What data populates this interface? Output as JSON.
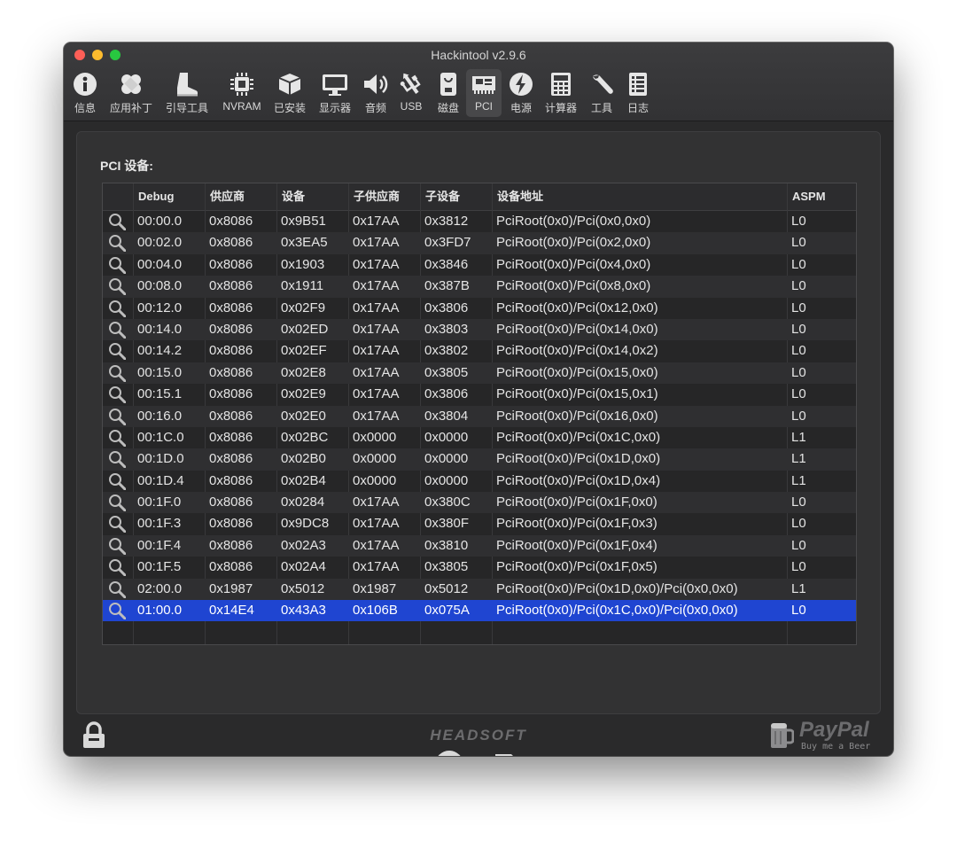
{
  "window": {
    "title": "Hackintool v2.9.6"
  },
  "toolbar": [
    {
      "label": "信息",
      "icon": "info-icon"
    },
    {
      "label": "应用补丁",
      "icon": "bandage-icon"
    },
    {
      "label": "引导工具",
      "icon": "boot-icon"
    },
    {
      "label": "NVRAM",
      "icon": "chip-icon"
    },
    {
      "label": "已安装",
      "icon": "box-icon"
    },
    {
      "label": "显示器",
      "icon": "monitor-icon"
    },
    {
      "label": "音频",
      "icon": "speaker-icon"
    },
    {
      "label": "USB",
      "icon": "usb-icon"
    },
    {
      "label": "磁盘",
      "icon": "disk-icon"
    },
    {
      "label": "PCI",
      "icon": "pci-card-icon",
      "active": true
    },
    {
      "label": "电源",
      "icon": "power-icon"
    },
    {
      "label": "计算器",
      "icon": "calculator-icon"
    },
    {
      "label": "工具",
      "icon": "wrench-icon"
    },
    {
      "label": "日志",
      "icon": "log-icon"
    }
  ],
  "section": {
    "title": "PCI 设备:"
  },
  "table": {
    "columns": [
      "",
      "Debug",
      "供应商",
      "设备",
      "子供应商",
      "子设备",
      "设备地址",
      "ASPM"
    ],
    "rows": [
      [
        "00:00.0",
        "0x8086",
        "0x9B51",
        "0x17AA",
        "0x3812",
        "PciRoot(0x0)/Pci(0x0,0x0)",
        "L0"
      ],
      [
        "00:02.0",
        "0x8086",
        "0x3EA5",
        "0x17AA",
        "0x3FD7",
        "PciRoot(0x0)/Pci(0x2,0x0)",
        "L0"
      ],
      [
        "00:04.0",
        "0x8086",
        "0x1903",
        "0x17AA",
        "0x3846",
        "PciRoot(0x0)/Pci(0x4,0x0)",
        "L0"
      ],
      [
        "00:08.0",
        "0x8086",
        "0x1911",
        "0x17AA",
        "0x387B",
        "PciRoot(0x0)/Pci(0x8,0x0)",
        "L0"
      ],
      [
        "00:12.0",
        "0x8086",
        "0x02F9",
        "0x17AA",
        "0x3806",
        "PciRoot(0x0)/Pci(0x12,0x0)",
        "L0"
      ],
      [
        "00:14.0",
        "0x8086",
        "0x02ED",
        "0x17AA",
        "0x3803",
        "PciRoot(0x0)/Pci(0x14,0x0)",
        "L0"
      ],
      [
        "00:14.2",
        "0x8086",
        "0x02EF",
        "0x17AA",
        "0x3802",
        "PciRoot(0x0)/Pci(0x14,0x2)",
        "L0"
      ],
      [
        "00:15.0",
        "0x8086",
        "0x02E8",
        "0x17AA",
        "0x3805",
        "PciRoot(0x0)/Pci(0x15,0x0)",
        "L0"
      ],
      [
        "00:15.1",
        "0x8086",
        "0x02E9",
        "0x17AA",
        "0x3806",
        "PciRoot(0x0)/Pci(0x15,0x1)",
        "L0"
      ],
      [
        "00:16.0",
        "0x8086",
        "0x02E0",
        "0x17AA",
        "0x3804",
        "PciRoot(0x0)/Pci(0x16,0x0)",
        "L0"
      ],
      [
        "00:1C.0",
        "0x8086",
        "0x02BC",
        "0x0000",
        "0x0000",
        "PciRoot(0x0)/Pci(0x1C,0x0)",
        "L1"
      ],
      [
        "00:1D.0",
        "0x8086",
        "0x02B0",
        "0x0000",
        "0x0000",
        "PciRoot(0x0)/Pci(0x1D,0x0)",
        "L1"
      ],
      [
        "00:1D.4",
        "0x8086",
        "0x02B4",
        "0x0000",
        "0x0000",
        "PciRoot(0x0)/Pci(0x1D,0x4)",
        "L1"
      ],
      [
        "00:1F.0",
        "0x8086",
        "0x0284",
        "0x17AA",
        "0x380C",
        "PciRoot(0x0)/Pci(0x1F,0x0)",
        "L0"
      ],
      [
        "00:1F.3",
        "0x8086",
        "0x9DC8",
        "0x17AA",
        "0x380F",
        "PciRoot(0x0)/Pci(0x1F,0x3)",
        "L0"
      ],
      [
        "00:1F.4",
        "0x8086",
        "0x02A3",
        "0x17AA",
        "0x3810",
        "PciRoot(0x0)/Pci(0x1F,0x4)",
        "L0"
      ],
      [
        "00:1F.5",
        "0x8086",
        "0x02A4",
        "0x17AA",
        "0x3805",
        "PciRoot(0x0)/Pci(0x1F,0x5)",
        "L0"
      ],
      [
        "02:00.0",
        "0x1987",
        "0x5012",
        "0x1987",
        "0x5012",
        "PciRoot(0x0)/Pci(0x1D,0x0)/Pci(0x0,0x0)",
        "L1"
      ],
      [
        "01:00.0",
        "0x14E4",
        "0x43A3",
        "0x106B",
        "0x075A",
        "PciRoot(0x0)/Pci(0x1C,0x0)/Pci(0x0,0x0)",
        "L0"
      ]
    ],
    "selected_row": 18
  },
  "actions": [
    {
      "name": "export-button",
      "icon": "download-icon"
    },
    {
      "name": "share-button",
      "icon": "share-icon"
    }
  ],
  "footer": {
    "brand": "HEADSOFT",
    "paypal": "PayPal",
    "paypal_sub": "Buy me a Beer"
  },
  "colors": {
    "selection": "#1f45d1",
    "background": "#2a2a2b"
  }
}
